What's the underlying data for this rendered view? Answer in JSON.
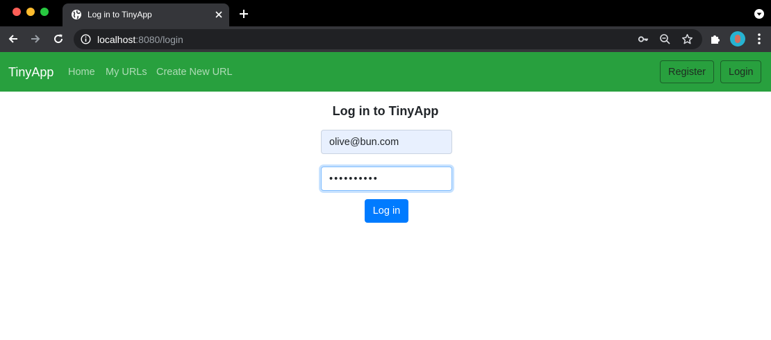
{
  "browser": {
    "tab": {
      "title": "Log in to TinyApp"
    },
    "address": {
      "host": "localhost",
      "rest": ":8080/login"
    }
  },
  "navbar": {
    "brand": "TinyApp",
    "links": [
      {
        "label": "Home"
      },
      {
        "label": "My URLs"
      },
      {
        "label": "Create New URL"
      }
    ],
    "register_label": "Register",
    "login_label": "Login",
    "background_color": "#28a03e"
  },
  "login": {
    "title": "Log in to TinyApp",
    "email_value": "olive@bun.com",
    "password_value": "••••••••••",
    "submit_label": "Log in",
    "submit_color": "#007bff"
  }
}
